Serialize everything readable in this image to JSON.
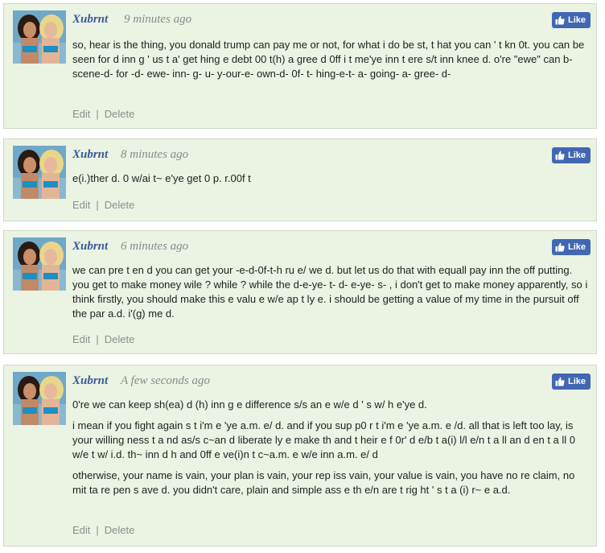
{
  "comments": [
    {
      "author": "Xubrnt",
      "time": "9 minutes ago",
      "like_label": "Like",
      "paragraphs": [
        "so, hear is the thing, you donald trump can pay me or not, for what i do be st, t hat you can ' t kn 0t. you can be seen for d inn g ' us t a' get hing e debt 00 t(h) a gree d 0ff i t me'ye inn t ere s/t inn knee d. o're \"ewe\" can b-scene-d- for -d- ewe- inn- g- u- y-our-e- own-d- 0f- t- hing-e-t- a- going- a- gree- d-"
      ],
      "edit_label": "Edit",
      "delete_label": "Delete"
    },
    {
      "author": "Xubrnt",
      "time": "8 minutes ago",
      "like_label": "Like",
      "paragraphs": [
        "e(i.)ther d. 0 w/ai t~ e'ye get 0 p. r.00f t"
      ],
      "edit_label": "Edit",
      "delete_label": "Delete"
    },
    {
      "author": "Xubrnt",
      "time": "6 minutes ago",
      "like_label": "Like",
      "paragraphs": [
        "we can pre t en d you can get your -e-d-0f-t-h ru e/ we d. but let us do that with equall pay inn the off putting. you get to make money wile ? while ? while the d-e-ye- t- d- e-ye- s- , i don't get to make money apparently, so i think firstly, you should make this e valu e w/e ap t ly e. i should be getting a value of my time in the pursuit off the par a.d. i'(g) me d."
      ],
      "edit_label": "Edit",
      "delete_label": "Delete"
    },
    {
      "author": "Xubrnt",
      "time": "A few seconds ago",
      "like_label": "Like",
      "paragraphs": [
        "0're we can keep sh(ea) d (h) inn g e difference s/s an e w/e d ' s w/ h e'ye d.",
        "i mean if you fight again s t i'm e 'ye a.m. e/ d. and if you sup p0 r t i'm e 'ye a.m. e /d. all that is left too lay, is your willing ness t a nd as/s c~an d liberate ly e make th and t heir e f 0r' d e/b t a(i) l/l e/n t a ll an d en t a ll 0 w/e t w/ i.d. th~ inn d h and 0ff e ve(i)n t c~a.m. e w/e inn a.m. e/ d",
        "otherwise, your name is vain, your plan is vain, your rep iss vain, your value is vain, you have no re claim, no mit ta re pen s ave d. you didn't care, plain and simple ass e th e/n are t rig ht ' s t a (i) r~ e a.d."
      ],
      "edit_label": "Edit",
      "delete_label": "Delete"
    }
  ],
  "colors": {
    "card_bg": "#ebf3e3",
    "card_border": "#cfd9c5",
    "author": "#3b5a9a",
    "like_button": "#4267b2",
    "meta_text": "#8c8c8c"
  },
  "icons": [
    "avatar-photo",
    "thumbs-up-icon"
  ]
}
